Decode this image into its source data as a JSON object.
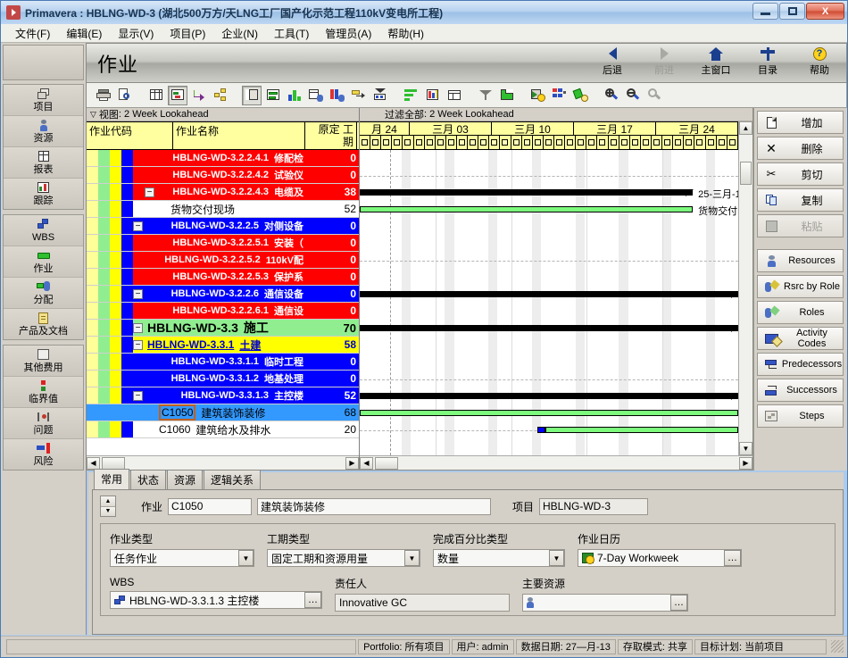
{
  "window": {
    "title": "Primavera : HBLNG-WD-3 (湖北500万方/天LNG工厂国产化示范工程110kV变电所工程)",
    "minimize": "—",
    "maximize": "□",
    "close": "X"
  },
  "menubar": {
    "items": [
      {
        "label": "文件(F)"
      },
      {
        "label": "编辑(E)"
      },
      {
        "label": "显示(V)"
      },
      {
        "label": "项目(P)"
      },
      {
        "label": "企业(N)"
      },
      {
        "label": "工具(T)"
      },
      {
        "label": "管理员(A)"
      },
      {
        "label": "帮助(H)"
      }
    ]
  },
  "sidebar": {
    "groups": [
      {
        "items": [
          {
            "label": "项目",
            "icon": "projects-icon"
          },
          {
            "label": "资源",
            "icon": "resources-icon"
          },
          {
            "label": "报表",
            "icon": "reports-icon"
          },
          {
            "label": "跟踪",
            "icon": "tracking-icon"
          }
        ]
      },
      {
        "items": [
          {
            "label": "WBS",
            "icon": "wbs-icon"
          },
          {
            "label": "作业",
            "icon": "activities-icon"
          },
          {
            "label": "分配",
            "icon": "assignments-icon"
          },
          {
            "label": "产品及文档",
            "icon": "documents-icon"
          }
        ]
      },
      {
        "items": [
          {
            "label": "其他费用",
            "icon": "expenses-icon"
          },
          {
            "label": "临界值",
            "icon": "thresholds-icon"
          },
          {
            "label": "问题",
            "icon": "issues-icon"
          },
          {
            "label": "风险",
            "icon": "risks-icon"
          }
        ]
      }
    ]
  },
  "banner": {
    "title": "作业",
    "actions": [
      {
        "label": "后退",
        "icon": "back-arrow-icon",
        "disabled": false
      },
      {
        "label": "前进",
        "icon": "forward-arrow-icon",
        "disabled": true
      },
      {
        "label": "主窗口",
        "icon": "home-icon",
        "disabled": false
      },
      {
        "label": "目录",
        "icon": "directory-icon",
        "disabled": false
      },
      {
        "label": "帮助",
        "icon": "help-icon",
        "disabled": false
      }
    ]
  },
  "toolbar": {
    "buttons": [
      {
        "name": "print-icon"
      },
      {
        "name": "print-preview-icon"
      },
      {
        "name": "table-view-icon"
      },
      {
        "name": "gantt-chart-icon"
      },
      {
        "name": "activity-network-icon"
      },
      {
        "name": "wbs-chart-icon"
      },
      {
        "name": "columns-icon"
      },
      {
        "name": "bars-icon"
      },
      {
        "name": "resource-profile-icon"
      },
      {
        "name": "activity-usage-icon"
      },
      {
        "name": "resource-usage-icon"
      },
      {
        "name": "relationship-lines-icon"
      },
      {
        "name": "progress-spotlight-icon"
      },
      {
        "name": "group-sort-icon"
      },
      {
        "name": "resource-histogram-icon"
      },
      {
        "name": "table-font-icon"
      },
      {
        "name": "filter-icon"
      },
      {
        "name": "layout-icon"
      },
      {
        "name": "schedule-icon"
      },
      {
        "name": "level-resources-icon"
      },
      {
        "name": "recalculate-icon"
      },
      {
        "name": "zoom-in-icon"
      },
      {
        "name": "zoom-out-icon"
      },
      {
        "name": "zoom-fit-icon"
      }
    ]
  },
  "grid": {
    "view_label": "视图",
    "view_name": "2 Week Lookahead",
    "filter_label": "过滤全部",
    "filter_name": "2 Week Lookahead",
    "columns": [
      {
        "key": "code",
        "label": "作业代码"
      },
      {
        "key": "name",
        "label": "作业名称"
      },
      {
        "key": "dur",
        "label": "原定工期"
      }
    ],
    "rows": [
      {
        "code": "HBLNG-WD-3.2.2.4.1",
        "name": "修配检",
        "dur": "0",
        "level": 4,
        "style": "red",
        "expander": false,
        "selected": false
      },
      {
        "code": "HBLNG-WD-3.2.2.4.2",
        "name": "试验仪",
        "dur": "0",
        "level": 4,
        "style": "red",
        "expander": false,
        "selected": false
      },
      {
        "code": "HBLNG-WD-3.2.2.4.3",
        "name": "电缆及",
        "dur": "38",
        "level": 4,
        "style": "red",
        "expander": true,
        "selected": false
      },
      {
        "code": "",
        "name": "货物交付现场",
        "dur": "52",
        "level": 5,
        "style": "white",
        "expander": false,
        "selected": false
      },
      {
        "code": "HBLNG-WD-3.2.2.5",
        "name": "对侧设备",
        "dur": "0",
        "level": 3,
        "style": "blue",
        "expander": true,
        "selected": false
      },
      {
        "code": "HBLNG-WD-3.2.2.5.1",
        "name": "安装（",
        "dur": "0",
        "level": 4,
        "style": "red",
        "expander": false,
        "selected": false
      },
      {
        "code": "HBLNG-WD-3.2.2.5.2",
        "name": "110kV配",
        "dur": "0",
        "level": 4,
        "style": "red",
        "expander": false,
        "selected": false
      },
      {
        "code": "HBLNG-WD-3.2.2.5.3",
        "name": "保护系",
        "dur": "0",
        "level": 4,
        "style": "red",
        "expander": false,
        "selected": false
      },
      {
        "code": "HBLNG-WD-3.2.2.6",
        "name": "通信设备",
        "dur": "0",
        "level": 3,
        "style": "blue",
        "expander": true,
        "selected": false
      },
      {
        "code": "HBLNG-WD-3.2.2.6.1",
        "name": "通信设",
        "dur": "0",
        "level": 4,
        "style": "red",
        "expander": false,
        "selected": false
      },
      {
        "code": "HBLNG-WD-3.3",
        "name": "施工",
        "dur": "70",
        "level": 1,
        "style": "green",
        "expander": true,
        "selected": false
      },
      {
        "code": "HBLNG-WD-3.3.1",
        "name": "土建",
        "dur": "58",
        "level": 2,
        "style": "yellow",
        "expander": true,
        "selected": false
      },
      {
        "code": "HBLNG-WD-3.3.1.1",
        "name": "临时工程",
        "dur": "0",
        "level": 3,
        "style": "blue",
        "expander": false,
        "selected": false
      },
      {
        "code": "HBLNG-WD-3.3.1.2",
        "name": "地基处理",
        "dur": "0",
        "level": 3,
        "style": "blue",
        "expander": false,
        "selected": false
      },
      {
        "code": "HBLNG-WD-3.3.1.3",
        "name": "主控楼",
        "dur": "52",
        "level": 3,
        "style": "blue",
        "expander": true,
        "selected": false
      },
      {
        "code": "C1050",
        "name": "建筑装饰装修",
        "dur": "68",
        "level": 4,
        "style": "selected",
        "expander": false,
        "selected": true
      },
      {
        "code": "C1060",
        "name": "建筑给水及排水",
        "dur": "20",
        "level": 4,
        "style": "white",
        "expander": false,
        "selected": false
      }
    ]
  },
  "timescale": {
    "months": [
      "月 24",
      "三月 03",
      "三月 10",
      "三月 17",
      "三月 24"
    ],
    "day_cells": 35
  },
  "chart_bars": [
    {
      "row": 2,
      "type": "summary",
      "label": "25-三月-1",
      "left_pct": 0,
      "width_pct": 88
    },
    {
      "row": 3,
      "type": "green",
      "label": "货物交付",
      "left_pct": 0,
      "width_pct": 88
    },
    {
      "row": 8,
      "type": "summary",
      "label": "",
      "left_pct": 0,
      "width_pct": 100
    },
    {
      "row": 10,
      "type": "summary",
      "label": "",
      "left_pct": 0,
      "width_pct": 100
    },
    {
      "row": 14,
      "type": "summary",
      "label": "",
      "left_pct": 0,
      "width_pct": 100
    },
    {
      "row": 15,
      "type": "green",
      "label": "",
      "left_pct": 0,
      "width_pct": 100
    },
    {
      "row": 16,
      "type": "blue-green",
      "label": "",
      "left_pct": 47,
      "width_pct": 53
    }
  ],
  "commands": {
    "groups": [
      {
        "items": [
          {
            "label": "增加",
            "icon": "add-page-icon",
            "disabled": false,
            "cn": true
          },
          {
            "label": "删除",
            "icon": "delete-x-icon",
            "disabled": false,
            "cn": true
          },
          {
            "label": "剪切",
            "icon": "cut-scissors-icon",
            "disabled": false,
            "cn": true
          },
          {
            "label": "复制",
            "icon": "copy-icon",
            "disabled": false,
            "cn": true
          },
          {
            "label": "粘贴",
            "icon": "paste-icon",
            "disabled": true,
            "cn": true
          }
        ]
      },
      {
        "items": [
          {
            "label": "Resources",
            "icon": "resource-person-icon",
            "disabled": false,
            "cn": false
          },
          {
            "label": "Rsrc by Role",
            "icon": "rsrc-by-role-icon",
            "disabled": false,
            "cn": false
          },
          {
            "label": "Roles",
            "icon": "roles-icon",
            "disabled": false,
            "cn": false
          },
          {
            "label": "Activity Codes",
            "icon": "activity-codes-icon",
            "disabled": false,
            "cn": false
          },
          {
            "label": "Predecessors",
            "icon": "predecessors-icon",
            "disabled": false,
            "cn": false
          },
          {
            "label": "Successors",
            "icon": "successors-icon",
            "disabled": false,
            "cn": false
          },
          {
            "label": "Steps",
            "icon": "steps-icon",
            "disabled": false,
            "cn": false
          }
        ]
      }
    ]
  },
  "details": {
    "tabs": [
      {
        "label": "常用",
        "active": true
      },
      {
        "label": "状态",
        "active": false
      },
      {
        "label": "资源",
        "active": false
      },
      {
        "label": "逻辑关系",
        "active": false
      }
    ],
    "activity_label": "作业",
    "activity_id": "C1050",
    "activity_name": "建筑装饰装修",
    "project_label": "项目",
    "project_value": "HBLNG-WD-3",
    "fields": {
      "activity_type_label": "作业类型",
      "activity_type_value": "任务作业",
      "duration_type_label": "工期类型",
      "duration_type_value": "固定工期和资源用量",
      "percent_type_label": "完成百分比类型",
      "percent_type_value": "数量",
      "calendar_label": "作业日历",
      "calendar_value": "7-Day Workweek",
      "wbs_label": "WBS",
      "wbs_value": "HBLNG-WD-3.3.1.3  主控楼",
      "responsible_label": "责任人",
      "responsible_value": "Innovative GC",
      "primary_resource_label": "主要资源",
      "primary_resource_value": ""
    }
  },
  "statusbar": {
    "cells": [
      {
        "text": "Portfolio: 所有项目"
      },
      {
        "text": "用户: admin"
      },
      {
        "text": "数据日期: 27—月-13"
      },
      {
        "text": "存取模式: 共享"
      },
      {
        "text": "目标计划: 当前项目"
      }
    ]
  }
}
